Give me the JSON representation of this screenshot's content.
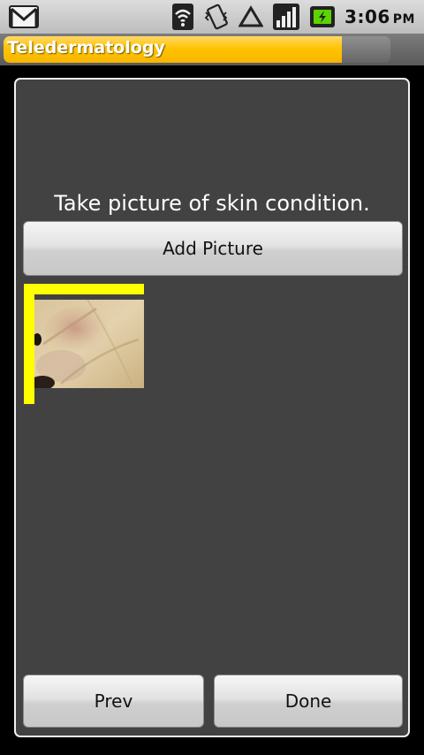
{
  "status_bar": {
    "time": "3:06",
    "ampm": "PM",
    "icons": [
      "gmail-icon",
      "wifi-icon",
      "vibrate-icon",
      "alert-triangle-icon",
      "signal-icon",
      "battery-charging-icon"
    ]
  },
  "app": {
    "title": "Teledermatology",
    "title_progress_fraction": 0.875,
    "accent_color": "#ffc400"
  },
  "main": {
    "instruction": "Take picture of skin condition.",
    "add_picture_label": "Add Picture",
    "thumbnail": {
      "icon": "skin-photo-thumbnail",
      "frame_color": "#ffff00"
    }
  },
  "footer": {
    "prev_label": "Prev",
    "done_label": "Done"
  }
}
